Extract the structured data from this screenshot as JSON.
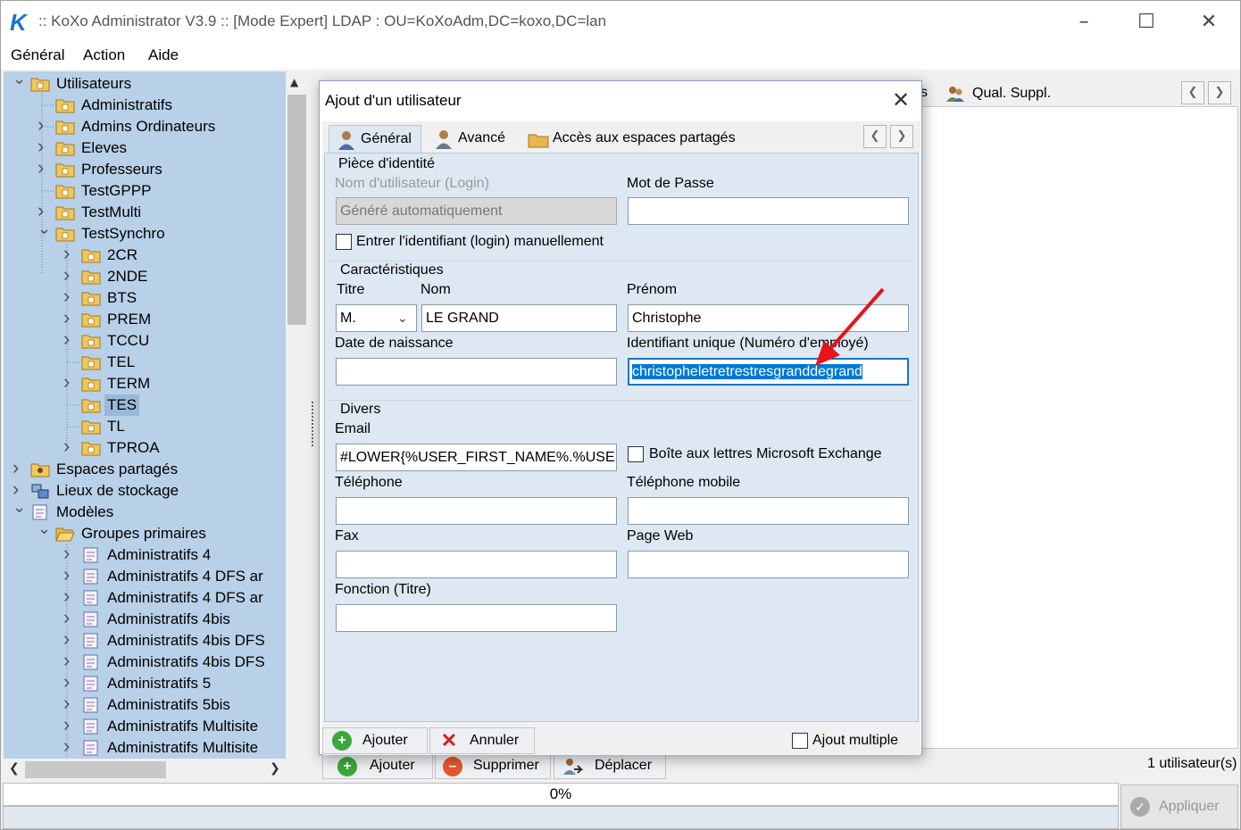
{
  "window": {
    "title": ":: KoXo Administrator V3.9 :: [Mode Expert] LDAP : OU=KoXoAdm,DC=koxo,DC=lan",
    "logo": "K"
  },
  "menu": [
    "Général",
    "Action",
    "Aide"
  ],
  "tree": {
    "items": [
      {
        "label": "Utilisateurs"
      },
      {
        "label": "Administratifs"
      },
      {
        "label": "Admins Ordinateurs"
      },
      {
        "label": "Eleves"
      },
      {
        "label": "Professeurs"
      },
      {
        "label": "TestGPPP"
      },
      {
        "label": "TestMulti"
      },
      {
        "label": "TestSynchro"
      },
      {
        "label": "2CR"
      },
      {
        "label": "2NDE"
      },
      {
        "label": "BTS"
      },
      {
        "label": "PREM"
      },
      {
        "label": "TCCU"
      },
      {
        "label": "TEL"
      },
      {
        "label": "TERM"
      },
      {
        "label": "TES"
      },
      {
        "label": "TL"
      },
      {
        "label": "TPROA"
      },
      {
        "label": "Espaces partagés"
      },
      {
        "label": "Lieux de stockage"
      },
      {
        "label": "Modèles"
      },
      {
        "label": "Groupes primaires"
      },
      {
        "label": "Administratifs 4"
      },
      {
        "label": "Administratifs 4 DFS ar"
      },
      {
        "label": "Administratifs 4 DFS ar"
      },
      {
        "label": "Administratifs 4bis"
      },
      {
        "label": "Administratifs 4bis DFS"
      },
      {
        "label": "Administratifs 4bis DFS"
      },
      {
        "label": "Administratifs 5"
      },
      {
        "label": "Administratifs 5bis"
      },
      {
        "label": "Administratifs Multisite"
      },
      {
        "label": "Administratifs Multisite"
      }
    ]
  },
  "right_panel": {
    "tab_partial": "s",
    "tab_qual": "Qual. Suppl.",
    "user_count": "1 utilisateur(s)",
    "btn_add": "Ajouter",
    "btn_delete": "Supprimer",
    "btn_move": "Déplacer"
  },
  "status": {
    "progress": "0%",
    "apply": "Appliquer"
  },
  "dialog": {
    "title": "Ajout d'un utilisateur",
    "tabs": [
      "Général",
      "Avancé",
      "Accès aux espaces partagés"
    ],
    "identity": {
      "section": "Pièce d'identité",
      "login_label": "Nom d'utilisateur (Login)",
      "login_value": "Généré automatiquement",
      "password_label": "Mot de Passe",
      "password_value": "",
      "manual_login_label": "Entrer l'identifiant (login) manuellement"
    },
    "characteristics": {
      "section": "Caractéristiques",
      "title_label": "Titre",
      "title_value": "M.",
      "name_label": "Nom",
      "name_value": "LE GRAND",
      "firstname_label": "Prénom",
      "firstname_value": "Christophe",
      "birthdate_label": "Date de naissance",
      "birthdate_value": "",
      "uid_label": "Identifiant unique (Numéro d'employé)",
      "uid_value": "christopheletretrestresgranddegrand"
    },
    "misc": {
      "section": "Divers",
      "email_label": "Email",
      "email_value": "#LOWER{%USER_FIRST_NAME%.%USE",
      "exchange_label": "Boîte aux lettres Microsoft Exchange",
      "phone_label": "Téléphone",
      "mobile_label": "Téléphone mobile",
      "fax_label": "Fax",
      "web_label": "Page Web",
      "function_label": "Fonction (Titre)"
    },
    "footer": {
      "add": "Ajouter",
      "cancel": "Annuler",
      "multiple": "Ajout multiple"
    }
  },
  "colors": {
    "tree_bg": "#b8d0e8",
    "panel_bg": "#dde8f3",
    "accent": "#1a73c8",
    "annotation_arrow": "#e8141b"
  }
}
